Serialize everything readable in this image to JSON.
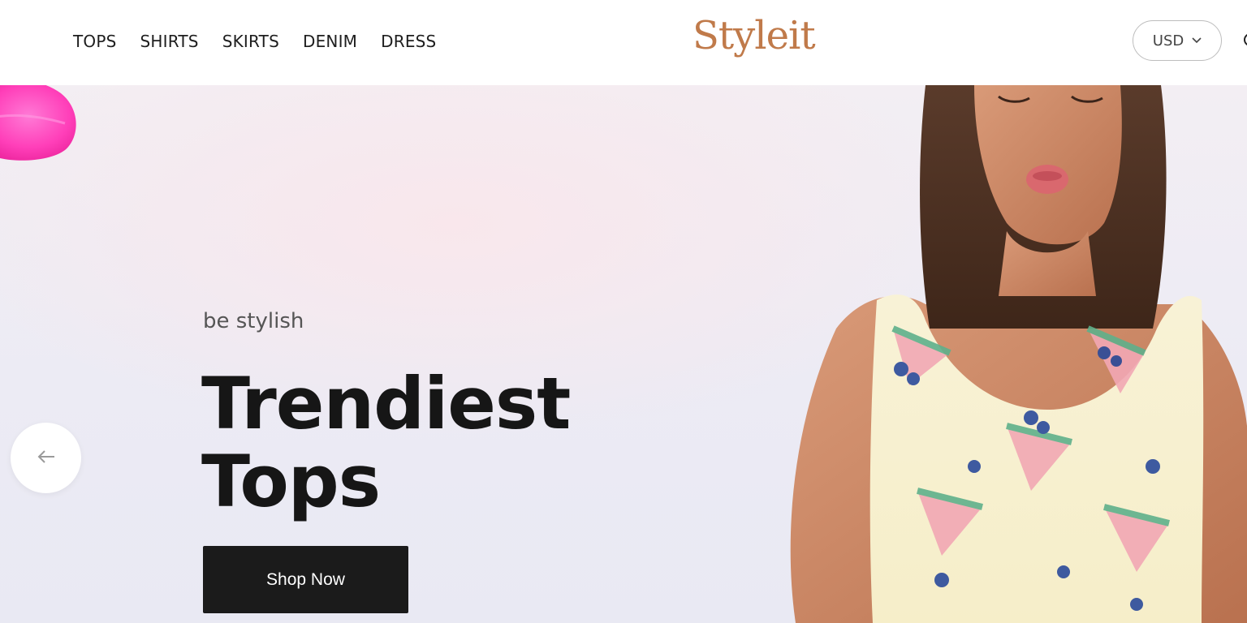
{
  "header": {
    "nav": [
      {
        "label": "TOPS"
      },
      {
        "label": "SHIRTS"
      },
      {
        "label": "SKIRTS"
      },
      {
        "label": "DENIM"
      },
      {
        "label": "DRESS"
      }
    ],
    "logo": "Styleit",
    "currency": {
      "value": "USD",
      "icon": "chevron-down-icon"
    }
  },
  "hero": {
    "eyebrow": "be stylish",
    "headline_line1": "Trendiest",
    "headline_line2": "Tops",
    "cta_label": "Shop Now",
    "prev_icon": "arrow-left-icon",
    "image": "woman-in-watermelon-print-top"
  },
  "colors": {
    "logo": "#c07a4a",
    "cta_background": "#1b1b1b",
    "petal": "#ff3fb9"
  }
}
